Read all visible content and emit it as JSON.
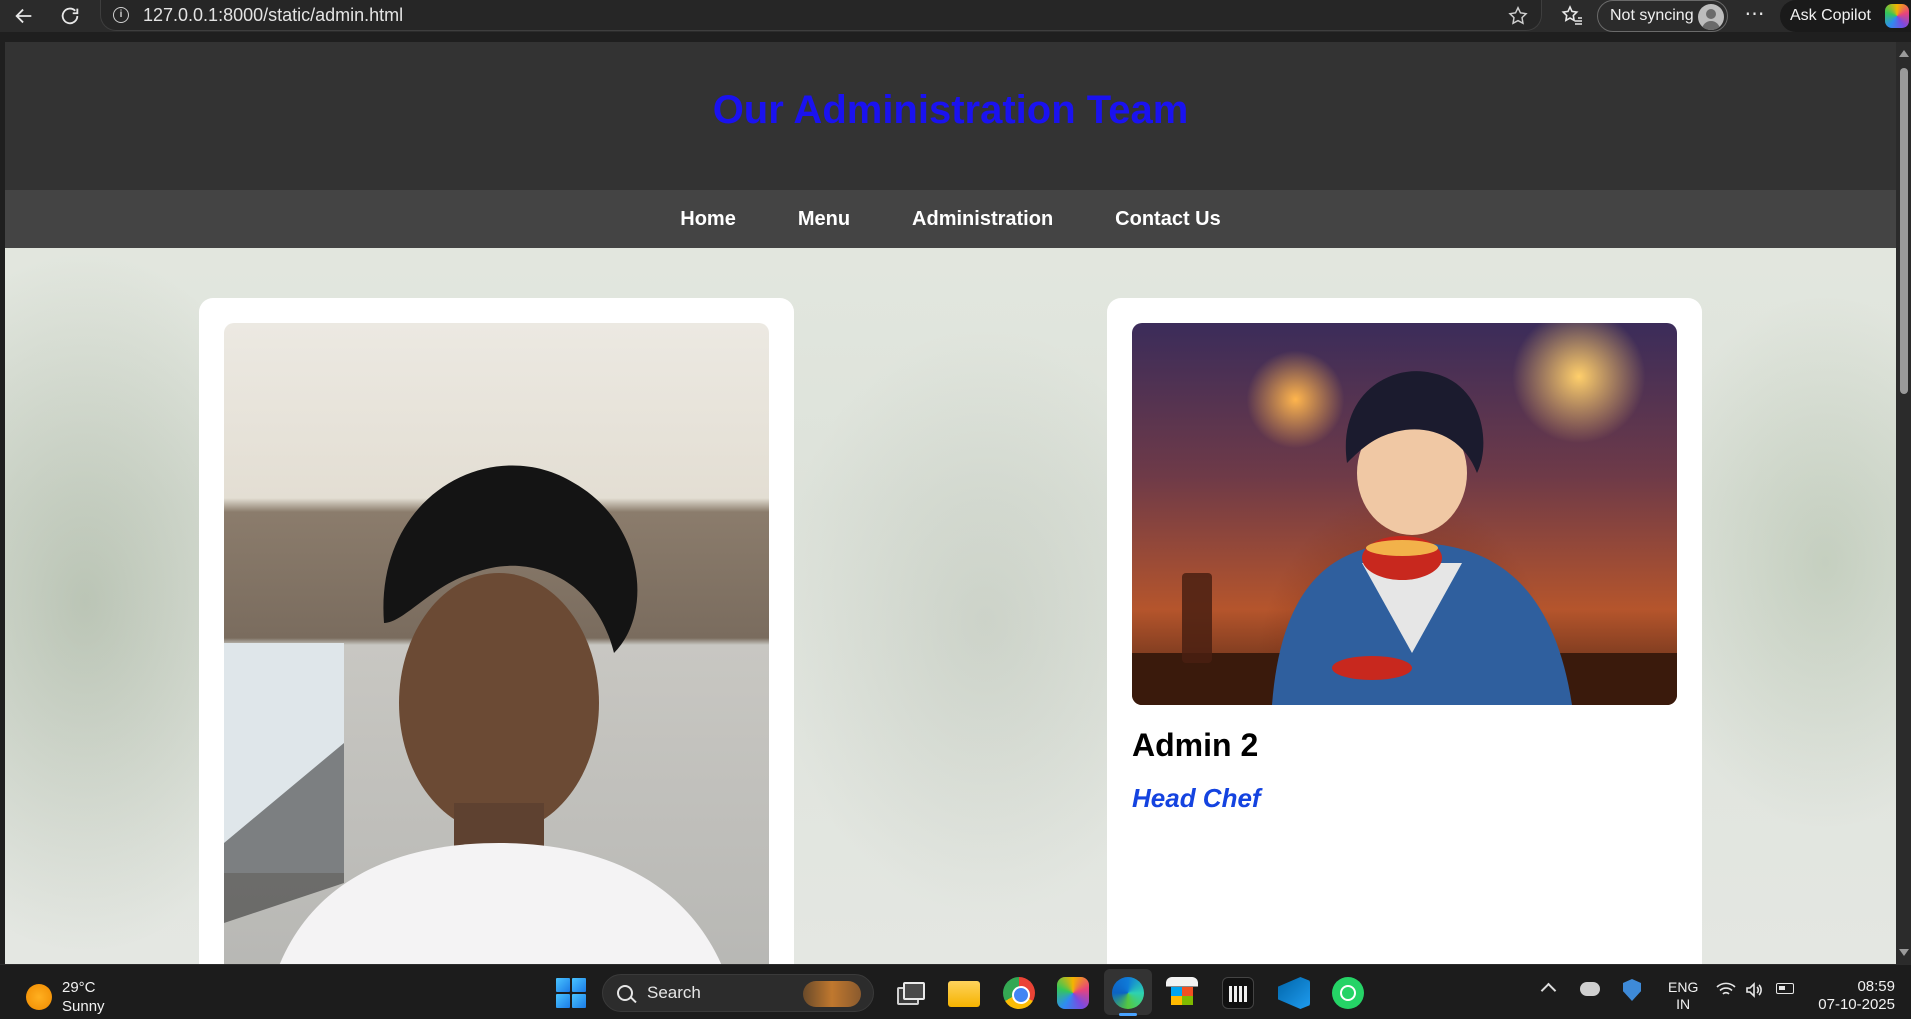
{
  "browser": {
    "url": "127.0.0.1:8000/static/admin.html",
    "sync_label": "Not syncing",
    "copilot_label": "Ask Copilot",
    "more_label": "⋯",
    "icons": [
      "back-icon",
      "refresh-icon",
      "info-icon",
      "favorite-star-icon",
      "favorites-icon",
      "profile-avatar-icon",
      "copilot-icon"
    ]
  },
  "site": {
    "title": "Our Administration Team",
    "nav": [
      {
        "label": "Home"
      },
      {
        "label": "Menu"
      },
      {
        "label": "Administration"
      },
      {
        "label": "Contact Us"
      }
    ],
    "colors": {
      "header_bg": "#333333",
      "nav_bg": "#444444",
      "title": "#1a12f0",
      "role": "#1443e0"
    }
  },
  "cards": [
    {
      "name": "",
      "role": "",
      "photo": "admin-1-photo"
    },
    {
      "name": "Admin 2",
      "role": "Head Chef",
      "photo": "admin-2-photo"
    }
  ],
  "taskbar": {
    "weather_temp": "29°C",
    "weather_desc": "Sunny",
    "search_label": "Search",
    "lang_line1": "ENG",
    "lang_line2": "IN",
    "time": "08:59",
    "date": "07-10-2025",
    "apps": [
      "start-icon",
      "task-view-icon",
      "file-explorer-icon",
      "chrome-icon",
      "copilot-app-icon",
      "edge-icon",
      "store-icon",
      "charts-app-icon",
      "vscode-icon",
      "whatsapp-icon"
    ]
  }
}
